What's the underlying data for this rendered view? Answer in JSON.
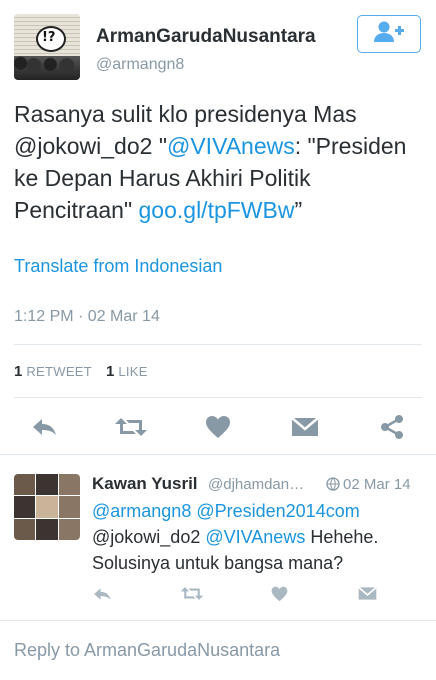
{
  "tweet": {
    "author_name": "ArmanGarudaNusantara",
    "author_handle": "@armangn8",
    "avatar_caption": "!?",
    "text_plain_1": "Rasanya sulit klo presidenya Mas @jokowi_do2 \"",
    "text_link_1": "@VIVAnews",
    "text_plain_2": ": \"Presiden ke Depan Harus Akhiri Politik Pencitraan\" ",
    "text_link_2": "goo.gl/tpFWBw",
    "text_plain_3": "”",
    "translate_label": "Translate from Indonesian",
    "timestamp": "1:12 PM · 02 Mar 14",
    "retweet_count": "1",
    "retweet_label": "RETWEET",
    "like_count": "1",
    "like_label": "LIKE"
  },
  "icons": {
    "follow": "add-user-icon",
    "reply": "reply-icon",
    "retweet": "retweet-icon",
    "like": "heart-icon",
    "message": "envelope-icon",
    "share": "share-icon",
    "globe": "globe-icon"
  },
  "colors": {
    "accent": "#1b95e0",
    "follow_border": "#55acee",
    "muted": "#8899a6",
    "icon": "#8899a6",
    "text": "#292f33"
  },
  "reply_tweet": {
    "author_name": "Kawan Yusril",
    "author_handle": "@djhamdan…",
    "time": "02 Mar 14",
    "mention_1": "@armangn8",
    "mention_2": "@Presiden2014com",
    "line_2_plain": "@jokowi_do2 ",
    "mention_3": "@VIVAnews",
    "line_2_rest": " Hehehe.",
    "line_3": "Solusinya untuk bangsa mana?"
  },
  "reply_box": {
    "placeholder": "Reply to ArmanGarudaNusantara"
  }
}
